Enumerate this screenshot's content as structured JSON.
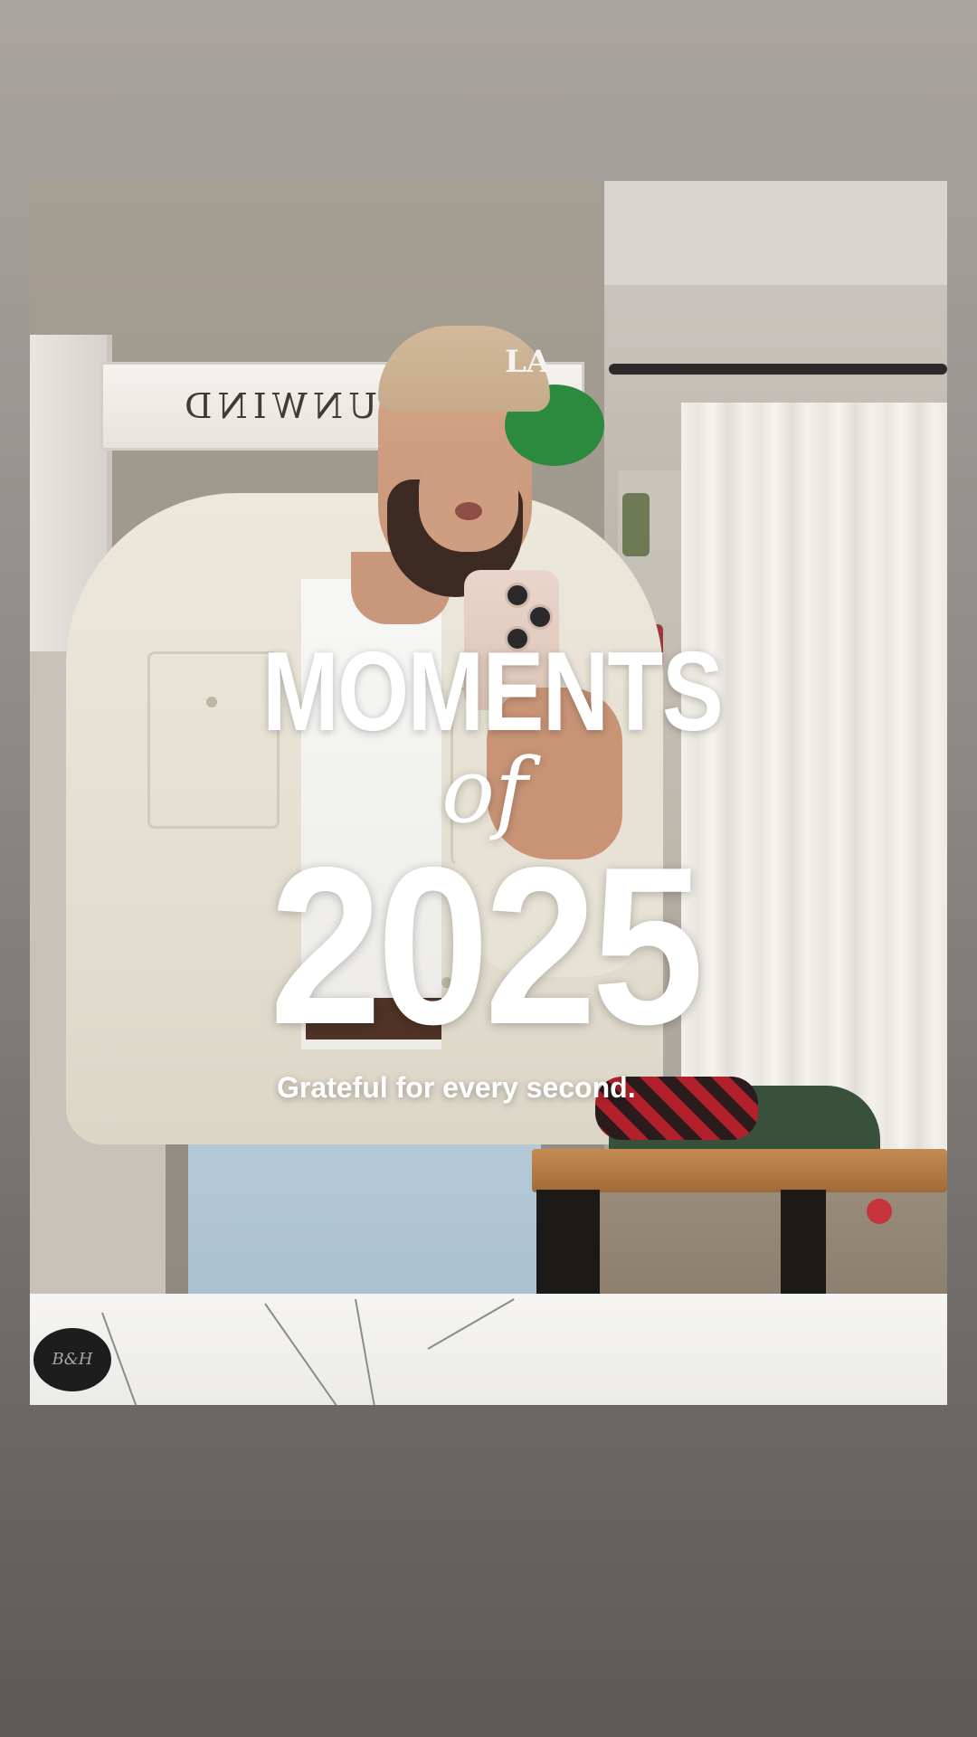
{
  "story": {
    "photo": {
      "wall_sign_text": "AK + UNWIND",
      "cap_logo": "LA",
      "counter_puck_text": "B&H"
    },
    "overlay": {
      "title_line1": "MOMENTS",
      "title_line2": "of",
      "title_line3": "2025",
      "subtitle": "Grateful for every second."
    }
  },
  "colors": {
    "background_top": "#a9a49f",
    "background_bottom": "#5c5957",
    "overlay_text": "#ffffff"
  }
}
